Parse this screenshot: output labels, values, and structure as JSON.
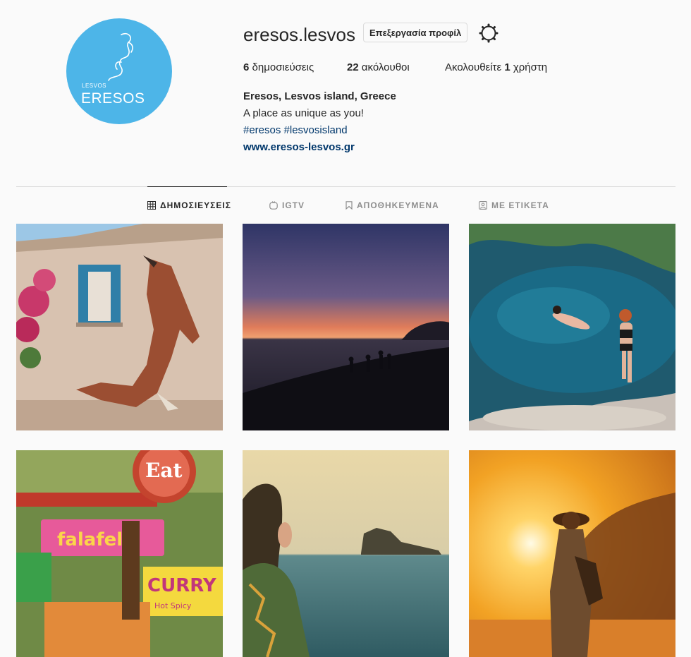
{
  "profile": {
    "username": "eresos.lesvos",
    "edit_button": "Επεξεργασία προφίλ",
    "avatar": {
      "small_text": "LESVOS",
      "big_text": "ERESOS",
      "bg": "#4db5e8"
    },
    "stats": {
      "posts_count": "6",
      "posts_label": " δημοσιεύσεις",
      "followers_count": "22",
      "followers_label": " ακόλουθοι",
      "following_prefix": "Ακολουθείτε ",
      "following_count": "1",
      "following_label": " χρήστη"
    },
    "bio": {
      "name": "Eresos, Lesvos island, Greece",
      "text": "A place as unique as you!",
      "tags": "#eresos #lesvosisland",
      "link": "www.eresos-lesvos.gr"
    }
  },
  "tabs": [
    {
      "label": "ΔΗΜΟΣΙΕΥΣΕΙΣ",
      "icon": "grid-icon"
    },
    {
      "label": "IGTV",
      "icon": "igtv-icon"
    },
    {
      "label": "ΑΠΟΘΗΚΕΥΜΕΝΑ",
      "icon": "bookmark-icon"
    },
    {
      "label": "ΜΕ ΕΤΙΚΕΤΑ",
      "icon": "tag-icon"
    }
  ],
  "photos": [
    {
      "description": "fox mural on house wall"
    },
    {
      "description": "sunset beach silhouettes"
    },
    {
      "description": "swimmers in green pool"
    },
    {
      "description": "colorful food signs"
    },
    {
      "description": "woman looking at sea rock"
    },
    {
      "description": "woman in hat at golden sunset"
    }
  ],
  "photo_signs": {
    "eat": "Eat",
    "falafel": "falafel",
    "curry": "CURRY",
    "hot_spicy": "Hot Spicy"
  },
  "colors": {
    "link": "#00376b",
    "text": "#262626",
    "muted": "#8e8e8e",
    "border": "#dbdbdb"
  }
}
